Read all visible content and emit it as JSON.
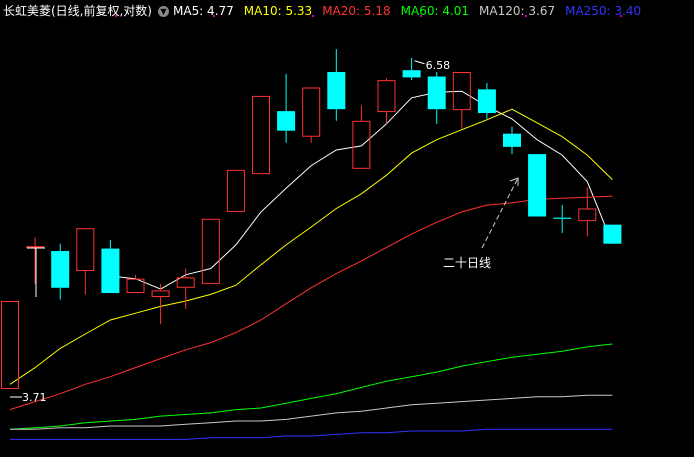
{
  "header": {
    "title": "长虹美菱(日线,前复权,对数)",
    "settings_icon": "chevron-down-icon"
  },
  "indicators": [
    {
      "label": "MA5: 4.77",
      "color": "#ffffff"
    },
    {
      "label": "MA10: 5.33",
      "color": "#ffff00"
    },
    {
      "label": "MA20: 5.18",
      "color": "#ff3333"
    },
    {
      "label": "MA60: 4.01",
      "color": "#00ff00"
    },
    {
      "label": "MA120: 3.67",
      "color": "#c8c8c8"
    },
    {
      "label": "MA250: 3.40",
      "color": "#3333ff"
    }
  ],
  "chart_data": {
    "type": "candlestick",
    "ylim": [
      3.35,
      7.0
    ],
    "log_scale": true,
    "grid": false,
    "candles": [
      {
        "o": 3.71,
        "c": 4.32,
        "h": 4.32,
        "l": 3.71
      },
      {
        "o": 4.75,
        "c": 4.75,
        "h": 4.82,
        "l": 4.45
      },
      {
        "o": 4.71,
        "c": 4.42,
        "h": 4.77,
        "l": 4.33
      },
      {
        "o": 4.55,
        "c": 4.9,
        "h": 4.9,
        "l": 4.37
      },
      {
        "o": 4.73,
        "c": 4.38,
        "h": 4.8,
        "l": 4.38
      },
      {
        "o": 4.38,
        "c": 4.49,
        "h": 4.52,
        "l": 4.38
      },
      {
        "o": 4.35,
        "c": 4.4,
        "h": 4.45,
        "l": 4.15
      },
      {
        "o": 4.42,
        "c": 4.5,
        "h": 4.57,
        "l": 4.26
      },
      {
        "o": 4.45,
        "c": 4.98,
        "h": 4.98,
        "l": 4.45
      },
      {
        "o": 5.04,
        "c": 5.42,
        "h": 5.42,
        "l": 5.04
      },
      {
        "o": 5.38,
        "c": 6.16,
        "h": 6.16,
        "l": 5.38
      },
      {
        "o": 6.0,
        "c": 5.8,
        "h": 6.4,
        "l": 5.68
      },
      {
        "o": 5.74,
        "c": 6.25,
        "h": 6.25,
        "l": 5.68
      },
      {
        "o": 6.42,
        "c": 6.02,
        "h": 6.68,
        "l": 5.9
      },
      {
        "o": 5.43,
        "c": 5.9,
        "h": 6.06,
        "l": 5.43
      },
      {
        "o": 5.99,
        "c": 6.33,
        "h": 6.35,
        "l": 5.87
      },
      {
        "o": 6.44,
        "c": 6.36,
        "h": 6.58,
        "l": 6.33
      },
      {
        "o": 6.37,
        "c": 6.02,
        "h": 6.42,
        "l": 5.87
      },
      {
        "o": 6.01,
        "c": 6.42,
        "h": 6.42,
        "l": 5.82
      },
      {
        "o": 6.23,
        "c": 5.98,
        "h": 6.3,
        "l": 5.92
      },
      {
        "o": 5.77,
        "c": 5.64,
        "h": 5.84,
        "l": 5.57
      },
      {
        "o": 5.57,
        "c": 5.0,
        "h": 5.57,
        "l": 5.0
      },
      {
        "o": 4.99,
        "c": 4.98,
        "h": 5.1,
        "l": 4.86
      },
      {
        "o": 4.96,
        "c": 5.07,
        "h": 5.26,
        "l": 4.83
      },
      {
        "o": 4.93,
        "c": 4.77,
        "h": 4.93,
        "l": 4.77
      }
    ],
    "series": [
      {
        "key": "ma5",
        "color": "#ffffff",
        "values": [
          null,
          null,
          null,
          null,
          4.51,
          4.49,
          4.41,
          4.52,
          4.57,
          4.76,
          5.04,
          5.25,
          5.46,
          5.61,
          5.65,
          5.87,
          6.14,
          6.2,
          6.21,
          6.05,
          5.92,
          5.71,
          5.56,
          5.31,
          4.77
        ]
      },
      {
        "key": "ma10",
        "color": "#ffff00",
        "values": [
          3.74,
          3.85,
          3.98,
          4.08,
          4.18,
          4.23,
          4.28,
          4.32,
          4.37,
          4.44,
          4.6,
          4.76,
          4.91,
          5.07,
          5.2,
          5.37,
          5.58,
          5.71,
          5.81,
          5.91,
          6.02,
          5.88,
          5.74,
          5.56,
          5.33
        ]
      },
      {
        "key": "ma20",
        "color": "#ff3333",
        "values": [
          3.58,
          3.63,
          3.68,
          3.74,
          3.79,
          3.85,
          3.91,
          3.97,
          4.02,
          4.09,
          4.18,
          4.3,
          4.42,
          4.53,
          4.63,
          4.74,
          4.85,
          4.95,
          5.04,
          5.1,
          5.12,
          5.15,
          5.16,
          5.17,
          5.18
        ]
      },
      {
        "key": "ma60",
        "color": "#00ff00",
        "values": [
          3.46,
          3.47,
          3.48,
          3.5,
          3.51,
          3.52,
          3.54,
          3.55,
          3.56,
          3.58,
          3.59,
          3.62,
          3.65,
          3.68,
          3.72,
          3.76,
          3.79,
          3.82,
          3.86,
          3.89,
          3.92,
          3.94,
          3.96,
          3.99,
          4.01
        ]
      },
      {
        "key": "ma120",
        "color": "#c8c8c8",
        "values": [
          3.46,
          3.46,
          3.47,
          3.47,
          3.48,
          3.48,
          3.48,
          3.49,
          3.5,
          3.51,
          3.51,
          3.52,
          3.54,
          3.56,
          3.57,
          3.59,
          3.61,
          3.62,
          3.63,
          3.64,
          3.65,
          3.66,
          3.66,
          3.67,
          3.67
        ]
      },
      {
        "key": "ma250",
        "color": "#3333ff",
        "values": [
          3.4,
          3.4,
          3.4,
          3.4,
          3.4,
          3.4,
          3.4,
          3.4,
          3.41,
          3.41,
          3.41,
          3.42,
          3.42,
          3.43,
          3.44,
          3.44,
          3.45,
          3.45,
          3.45,
          3.46,
          3.46,
          3.46,
          3.46,
          3.46,
          3.46
        ]
      }
    ],
    "annotations": {
      "high_label": "6.58",
      "low_label": "3.71",
      "ma20_label": "二十日线"
    }
  }
}
